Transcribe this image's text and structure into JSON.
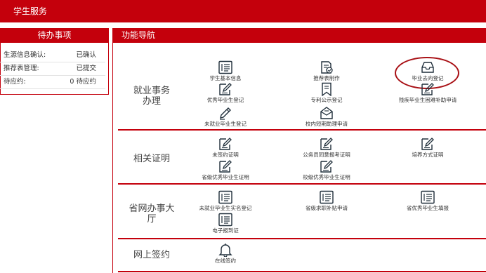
{
  "header": {
    "title": "学生服务"
  },
  "todo": {
    "title": "待办事项",
    "rows": [
      {
        "label": "生源信息确认:",
        "value": "已确认"
      },
      {
        "label": "推荐表管理:",
        "value": "已提交"
      },
      {
        "label": "待应约:",
        "value": "0 待应约"
      }
    ]
  },
  "nav": {
    "title": "功能导航",
    "categories": [
      {
        "name": "就业事务办理",
        "items": [
          {
            "label": "学生基本信息",
            "icon": "form-icon"
          },
          {
            "label": "推荐表制作",
            "icon": "document-edit-icon"
          },
          {
            "label": "毕业去向登记",
            "icon": "inbox-icon"
          },
          {
            "label": "优秀毕业生登记",
            "icon": "edit-icon"
          },
          {
            "label": "专利公示登记",
            "icon": "bookmark-icon"
          },
          {
            "label": "残疾毕业生困难补助申请",
            "icon": "edit-icon"
          },
          {
            "label": "未就业毕业生登记",
            "icon": "pencil-icon"
          },
          {
            "label": "校内短期助理申请",
            "icon": "envelope-icon"
          }
        ]
      },
      {
        "name": "相关证明",
        "items": [
          {
            "label": "未签约证明",
            "icon": "edit-icon"
          },
          {
            "label": "公务员同意报考证明",
            "icon": "edit-icon"
          },
          {
            "label": "培养方式证明",
            "icon": "edit-icon"
          },
          {
            "label": "省级优秀毕业生证明",
            "icon": "edit-icon"
          },
          {
            "label": "校级优秀毕业生证明",
            "icon": "edit-icon"
          }
        ]
      },
      {
        "name": "省网办事大厅",
        "items": [
          {
            "label": "未就业毕业生实名登记",
            "icon": "form-icon"
          },
          {
            "label": "省级求职补贴申请",
            "icon": "form-icon"
          },
          {
            "label": "省优秀毕业生填报",
            "icon": "form-icon"
          },
          {
            "label": "电子报到证",
            "icon": "form-icon"
          }
        ]
      },
      {
        "name": "网上签约",
        "items": [
          {
            "label": "在线签约",
            "icon": "bell-icon"
          }
        ]
      }
    ]
  },
  "colors": {
    "brand": "#c4000c",
    "icon": "#1f2e3a",
    "highlight": "#a80f14"
  }
}
